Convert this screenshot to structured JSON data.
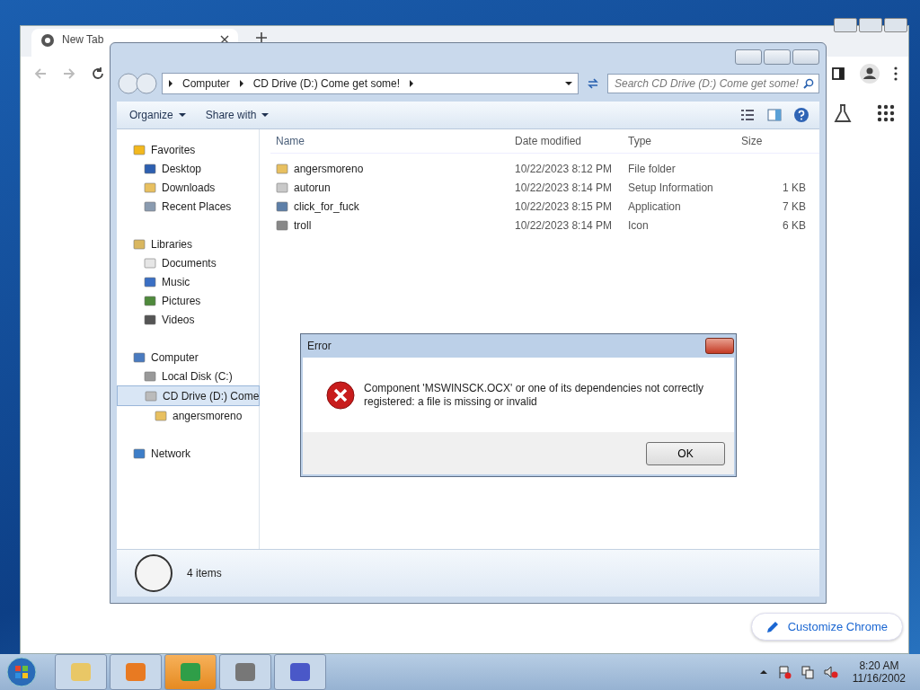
{
  "chrome": {
    "tab": "New Tab",
    "customize": "Customize Chrome"
  },
  "explorer": {
    "breadcrumb": [
      "Computer",
      "CD Drive (D:) Come get some!"
    ],
    "search_placeholder": "Search CD Drive (D:) Come get some!",
    "toolbar": [
      "Organize",
      "Share with"
    ],
    "nav": [
      {
        "label": "Favorites",
        "kind": "star",
        "selected": false,
        "children": [
          {
            "label": "Desktop",
            "kind": "desktop",
            "selected": false
          },
          {
            "label": "Downloads",
            "kind": "folder",
            "selected": false
          },
          {
            "label": "Recent Places",
            "kind": "recent",
            "selected": false
          }
        ]
      },
      {
        "label": "Libraries",
        "kind": "library",
        "selected": false,
        "children": [
          {
            "label": "Documents",
            "kind": "doc",
            "selected": false
          },
          {
            "label": "Music",
            "kind": "music",
            "selected": false
          },
          {
            "label": "Pictures",
            "kind": "pictures",
            "selected": false
          },
          {
            "label": "Videos",
            "kind": "video",
            "selected": false
          }
        ]
      },
      {
        "label": "Computer",
        "kind": "computer",
        "selected": false,
        "children": [
          {
            "label": "Local Disk (C:)",
            "kind": "disk",
            "selected": false
          },
          {
            "label": "CD Drive (D:) Come",
            "kind": "cd",
            "selected": true,
            "children": [
              {
                "label": "angersmoreno",
                "kind": "folder",
                "selected": false
              }
            ]
          }
        ]
      },
      {
        "label": "Network",
        "kind": "network",
        "selected": false
      }
    ],
    "columns": [
      "Name",
      "Date modified",
      "Type",
      "Size"
    ],
    "files": [
      {
        "name": "angersmoreno",
        "date": "10/22/2023 8:12 PM",
        "type": "File folder",
        "kind": "folder"
      },
      {
        "name": "autorun",
        "date": "10/22/2023 8:14 PM",
        "type": "Setup Information",
        "size": "1 KB",
        "kind": "settings"
      },
      {
        "name": "click_for_fuck",
        "date": "10/22/2023 8:15 PM",
        "type": "Application",
        "size": "7 KB",
        "kind": "app"
      },
      {
        "name": "troll",
        "date": "10/22/2023 8:14 PM",
        "type": "Icon",
        "size": "6 KB",
        "kind": "image"
      }
    ],
    "status": "4 items"
  },
  "dialog": {
    "title": "Error",
    "message": "Component 'MSWINSCK.OCX' or one of its dependencies not correctly registered: a file is missing or invalid",
    "button": "OK"
  },
  "taskbar": {
    "apps": [
      {
        "kind": "explorer"
      },
      {
        "kind": "media"
      },
      {
        "kind": "chrome"
      },
      {
        "kind": "rocket"
      },
      {
        "kind": "setup"
      }
    ],
    "time": "8:20 AM",
    "date": "11/16/2002"
  }
}
